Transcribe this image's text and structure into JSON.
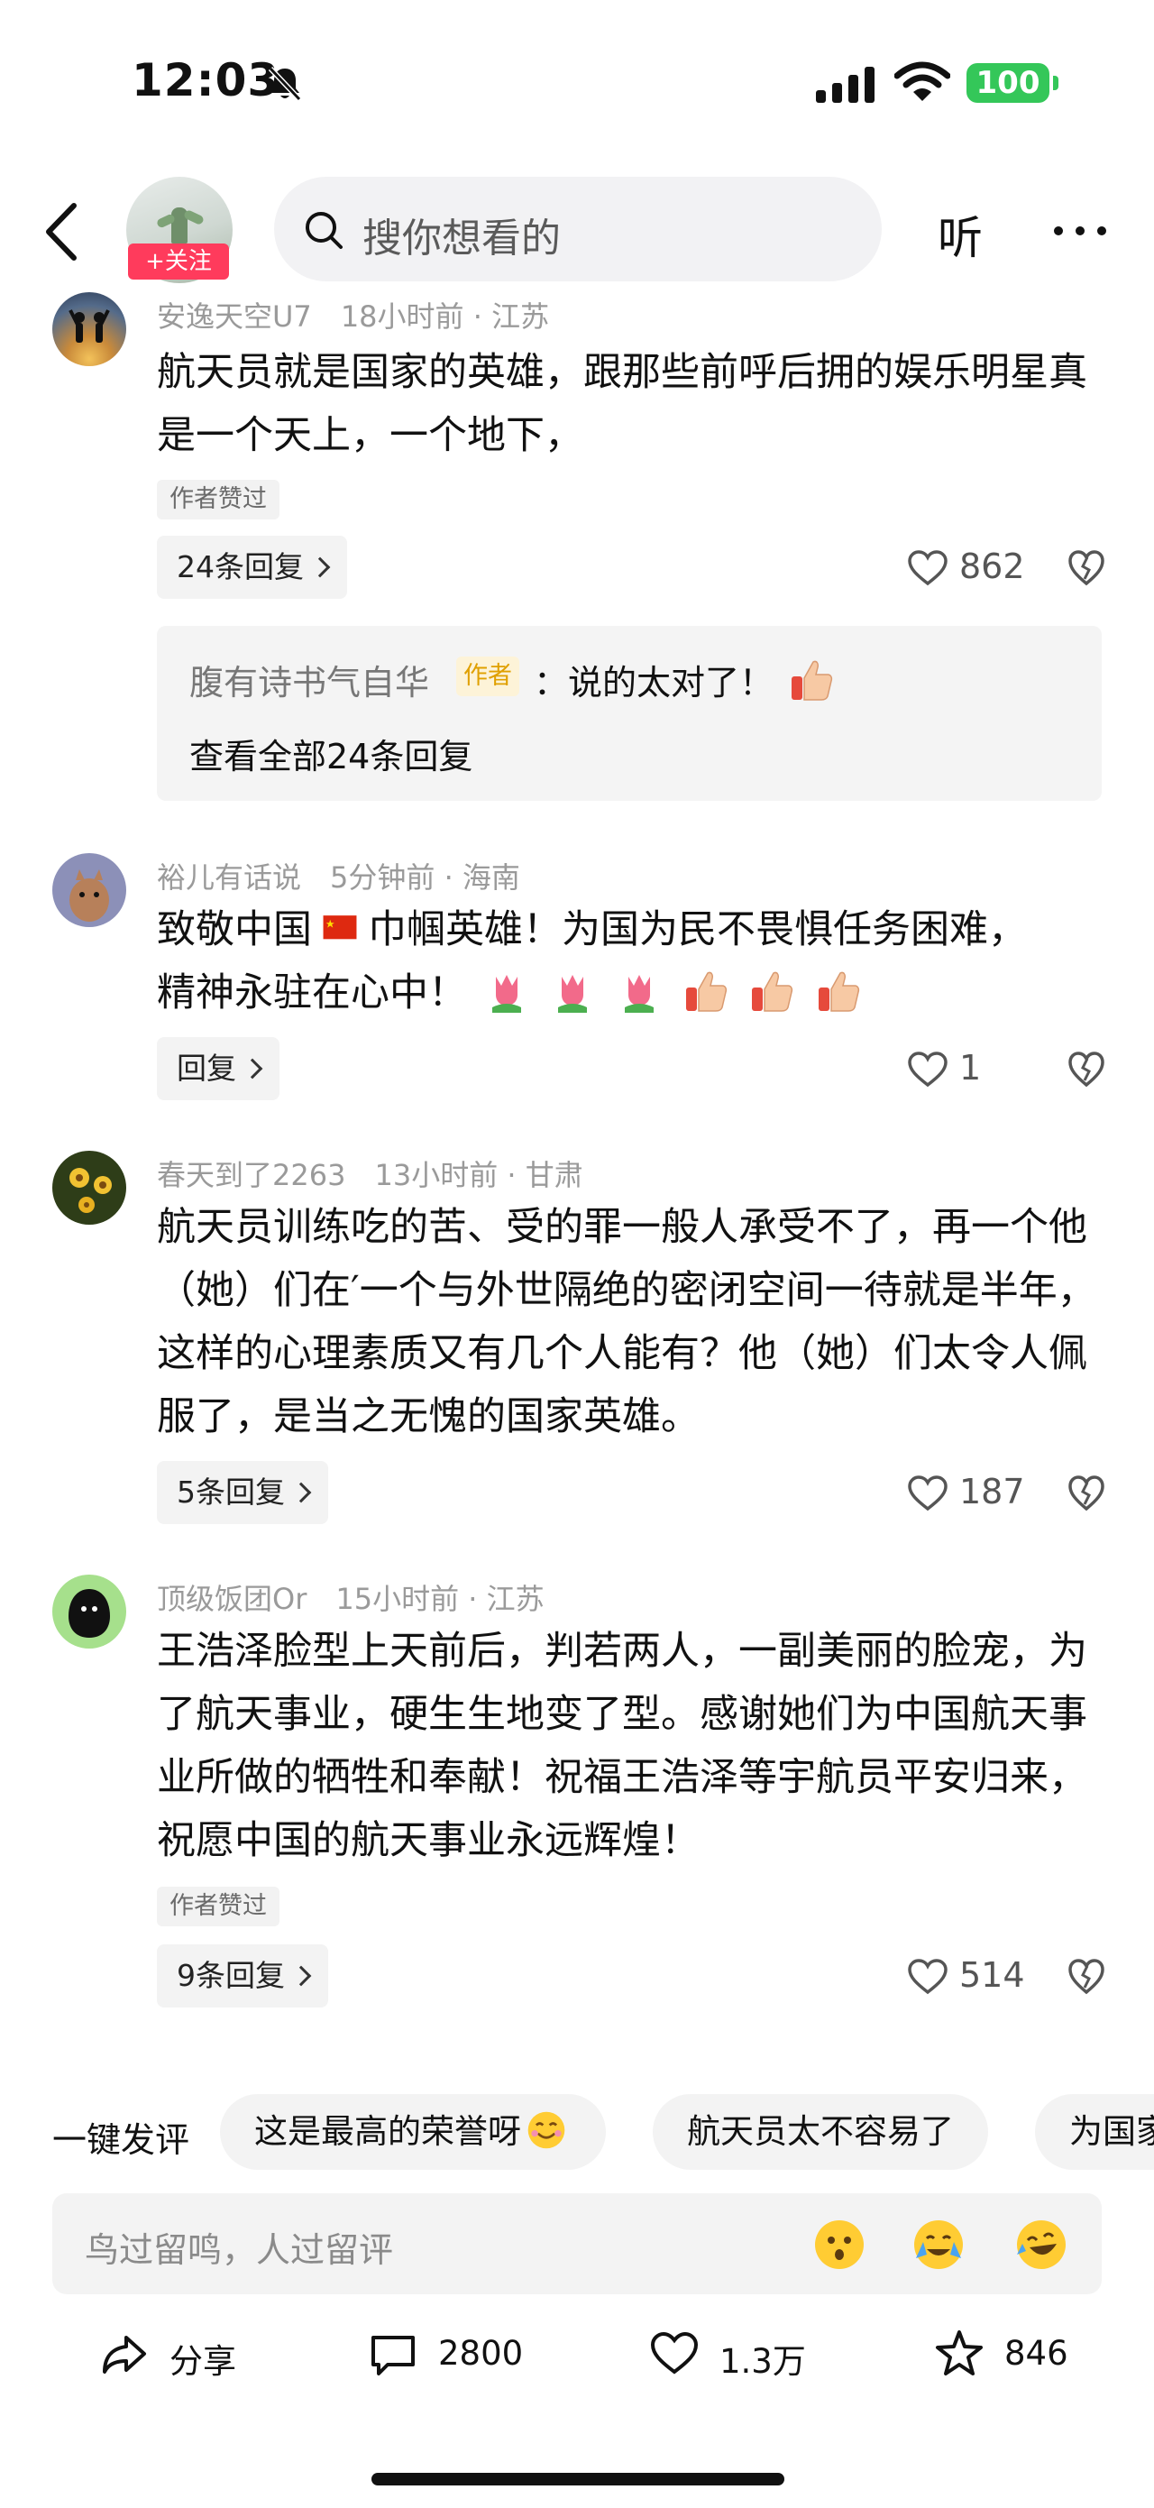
{
  "status_bar": {
    "time": "12:03",
    "battery": "100"
  },
  "header": {
    "follow_label": "+关注",
    "search_placeholder": "搜你想看的",
    "listen_label": "听"
  },
  "comments": [
    {
      "user": "安逸天空U7",
      "time": "18小时前",
      "location": "江苏",
      "text": "航天员就是国家的英雄，跟那些前呼后拥的娱乐明星真是一个天上，一个地下，",
      "badge": "作者赞过",
      "reply_label": "24条回复",
      "likes": "862",
      "author_reply": {
        "name": "腹有诗书气自华",
        "tag": "作者",
        "text": "：说的太对了！",
        "more": "查看全部24条回复"
      }
    },
    {
      "user": "裕儿有话说",
      "time": "5分钟前",
      "location": "海南",
      "text_1": "致敬中国",
      "text_2": "巾帼英雄！为国为民不畏惧任务困难，",
      "text_3": "精神永驻在心中！",
      "reply_label": "回复",
      "likes": "1"
    },
    {
      "user": "春天到了2263",
      "time": "13小时前",
      "location": "甘肃",
      "text": "航天员训练吃的苦、受的罪一般人承受不了，再一个他（她）们在′一个与外世隔绝的密闭空间一待就是半年，这样的心理素质又有几个人能有？他（她）们太令人佩服了，是当之无愧的国家英雄。",
      "reply_label": "5条回复",
      "likes": "187"
    },
    {
      "user": "顶级饭团Or",
      "time": "15小时前",
      "location": "江苏",
      "text": "王浩泽脸型上天前后，判若两人，一副美丽的脸宠，为了航天事业，硬生生地变了型。感谢她们为中国航天事业所做的牺牲和奉献！祝福王浩泽等宇航员平安归来，祝愿中国的航天事业永远辉煌！",
      "badge": "作者赞过",
      "reply_label": "9条回复",
      "likes": "514"
    }
  ],
  "quick_reply": {
    "label": "一键发评",
    "chips": [
      "这是最高的荣誉呀",
      "航天员太不容易了",
      "为国家"
    ]
  },
  "input": {
    "placeholder": "鸟过留鸣，人过留评"
  },
  "bottom_bar": {
    "share": "分享",
    "comments": "2800",
    "likes": "1.3万",
    "favorites": "846"
  },
  "colors": {
    "follow": "#ff3b5c",
    "battery": "#34c759",
    "author_tag": "#e0a000"
  }
}
